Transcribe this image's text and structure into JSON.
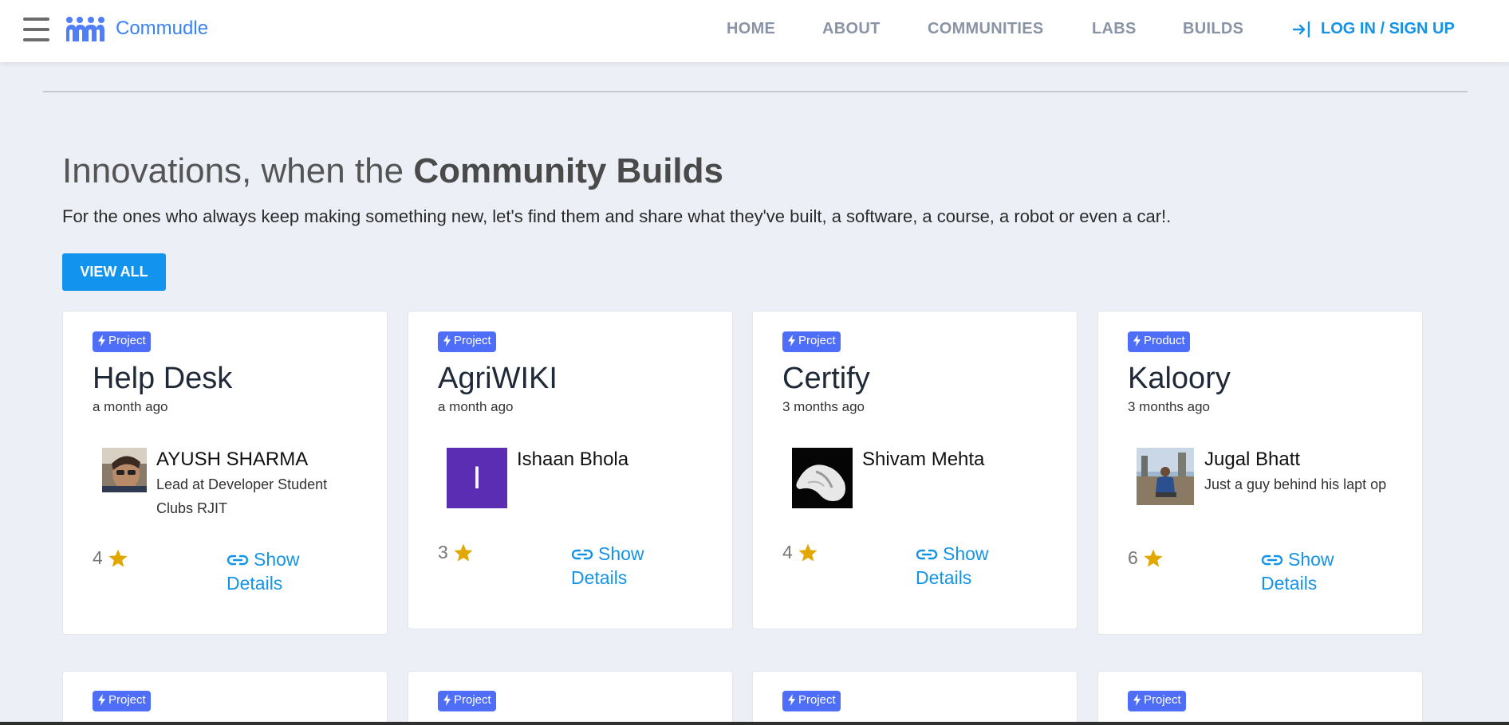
{
  "header": {
    "brand": "Commudle",
    "nav": [
      "HOME",
      "ABOUT",
      "COMMUNITIES",
      "LABS",
      "BUILDS"
    ],
    "login": "LOG IN / SIGN UP"
  },
  "hero": {
    "headline_prefix": "Innovations, when the ",
    "headline_bold": "Community Builds",
    "subline": "For the ones who always keep making something new, let's find them and share what they've built, a software, a course, a robot or even a car!.",
    "view_all": "VIEW ALL"
  },
  "cards": [
    {
      "badge": "Project",
      "title": "Help Desk",
      "time": "a month ago",
      "author": "AYUSH SHARMA",
      "bio": "Lead at Developer Student Clubs RJIT",
      "avatar_initial": "",
      "rating": "4",
      "details": "Show Details"
    },
    {
      "badge": "Project",
      "title": "AgriWIKI",
      "time": "a month ago",
      "author": "Ishaan Bhola",
      "bio": "",
      "avatar_initial": "I",
      "rating": "3",
      "details": "Show Details"
    },
    {
      "badge": "Project",
      "title": "Certify",
      "time": "3 months ago",
      "author": "Shivam Mehta",
      "bio": "",
      "avatar_initial": "",
      "rating": "4",
      "details": "Show Details"
    },
    {
      "badge": "Product",
      "title": "Kaloory",
      "time": "3 months ago",
      "author": "Jugal Bhatt",
      "bio": "Just a guy behind his lapt op",
      "avatar_initial": "",
      "rating": "6",
      "details": "Show Details"
    }
  ],
  "next_row_badges": [
    "Project",
    "Project",
    "Project",
    "Project"
  ],
  "colors": {
    "accent": "#1293ee",
    "badge": "#4f6ef7",
    "star": "#e0a800",
    "avatar_initial_bg": "#5b2db3"
  }
}
